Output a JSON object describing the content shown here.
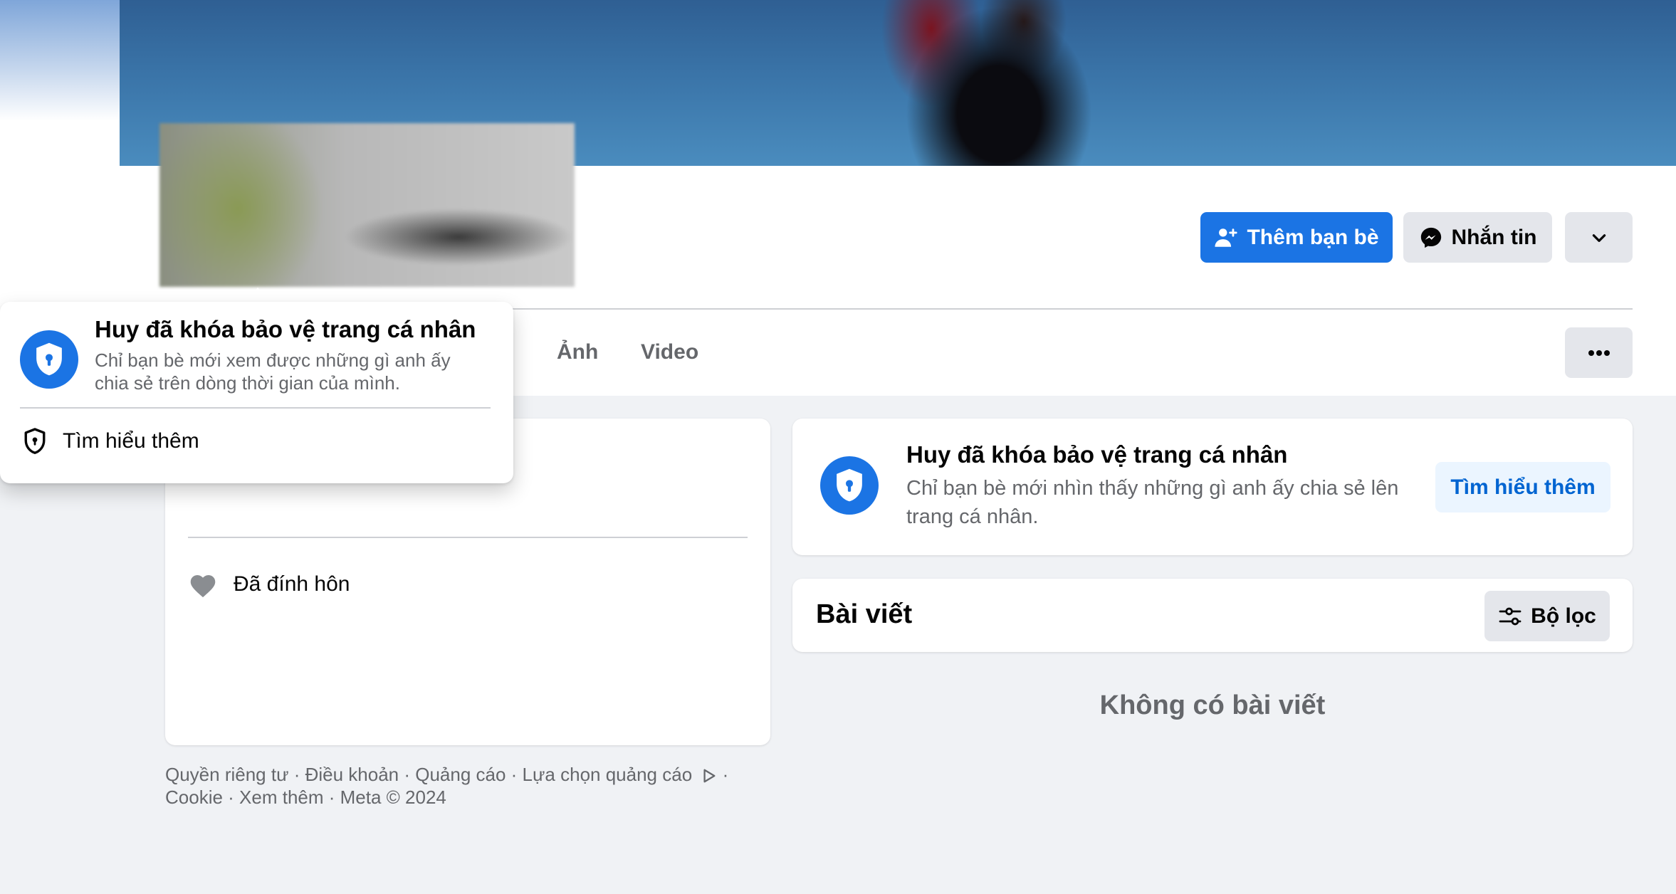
{
  "header": {
    "add_friend_label": "Thêm bạn bè",
    "message_label": "Nhắn tin",
    "more_icon": "chevron-down-icon"
  },
  "tabs": [
    {
      "label": "Ảnh"
    },
    {
      "label": "Video"
    }
  ],
  "tabs_more_icon": "ellipsis-icon",
  "popover": {
    "title": "Huy đã khóa bảo vệ trang cá nhân",
    "desc_line1": "Chỉ bạn bè mới xem được những gì anh ấy",
    "desc_line2": "chia sẻ trên dòng thời gian của mình.",
    "learn_more": "Tìm hiểu thêm"
  },
  "intro": {
    "relationship": "Đã đính hôn"
  },
  "lock_card": {
    "title": "Huy đã khóa bảo vệ trang cá nhân",
    "desc_line1": "Chỉ bạn bè mới nhìn thấy những gì anh ấy chia sẻ lên",
    "desc_line2": "trang cá nhân.",
    "button": "Tìm hiểu thêm"
  },
  "posts": {
    "title": "Bài viết",
    "filter_label": "Bộ lọc",
    "empty": "Không có bài viết"
  },
  "footer": {
    "line1": "Quyền riêng tư · Điều khoản · Quảng cáo · Lựa chọn quảng cáo",
    "line1_suffix": " ·",
    "line2": "Cookie · Xem thêm · Meta © 2024"
  },
  "colors": {
    "accent": "#1b74e4",
    "background": "#f0f2f5",
    "secondary_text": "#65676b"
  }
}
